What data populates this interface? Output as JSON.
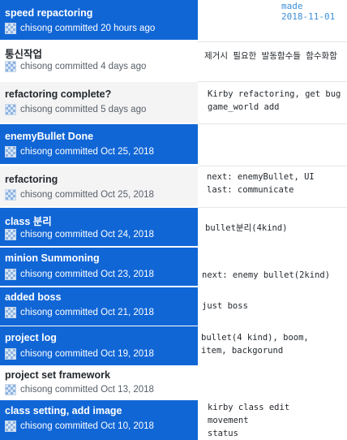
{
  "header": {
    "made_label": "made",
    "made_date": "2018-11-01"
  },
  "commits": [
    {
      "title": "speed repactoring",
      "author": "chisong",
      "verb": "committed",
      "when": "20 hours ago",
      "style": "blue"
    },
    {
      "title": "통신작업",
      "author": "chisong",
      "verb": "committed",
      "when": "4 days ago",
      "style": "white"
    },
    {
      "title": "refactoring complete?",
      "author": "chisong",
      "verb": "committed",
      "when": "5 days ago",
      "style": "grey"
    },
    {
      "title": "enemyBullet Done",
      "author": "chisong",
      "verb": "committed",
      "when": "Oct 25, 2018",
      "style": "blue"
    },
    {
      "title": "refactoring",
      "author": "chisong",
      "verb": "committed",
      "when": "Oct 25, 2018",
      "style": "grey"
    },
    {
      "title": "class 분리",
      "author": "chisong",
      "verb": "committed",
      "when": "Oct 24, 2018",
      "style": "blue"
    },
    {
      "title": "minion Summoning",
      "author": "chisong",
      "verb": "committed",
      "when": "Oct 23, 2018",
      "style": "blue"
    },
    {
      "title": "added boss",
      "author": "chisong",
      "verb": "committed",
      "when": "Oct 21, 2018",
      "style": "blue"
    },
    {
      "title": "project log",
      "author": "chisong",
      "verb": "committed",
      "when": "Oct 19, 2018",
      "style": "blue"
    },
    {
      "title": "project set framework",
      "author": "chisong",
      "verb": "committed",
      "when": "Oct 13, 2018",
      "style": "white"
    },
    {
      "title": "class setting, add image",
      "author": "chisong",
      "verb": "committed",
      "when": "Oct 10, 2018",
      "style": "blue"
    }
  ],
  "notes": [
    {
      "lines": [
        "제거시 필요한 발동함수들 함수화함"
      ]
    },
    {
      "lines": [
        "Kirby refactoring, get bug",
        "game_world add"
      ]
    },
    {
      "lines": [
        "next: enemyBullet, UI",
        "last: communicate"
      ]
    },
    {
      "lines": [
        "bullet분리(4kind)"
      ]
    },
    {
      "lines": [
        "next: enemy bullet(2kind)"
      ]
    },
    {
      "lines": [
        "just boss"
      ]
    },
    {
      "lines": [
        "bullet(4 kind), boom,",
        "item, backgorund"
      ]
    },
    {
      "lines": [
        "kirby class edit",
        "movement",
        "status"
      ]
    }
  ]
}
